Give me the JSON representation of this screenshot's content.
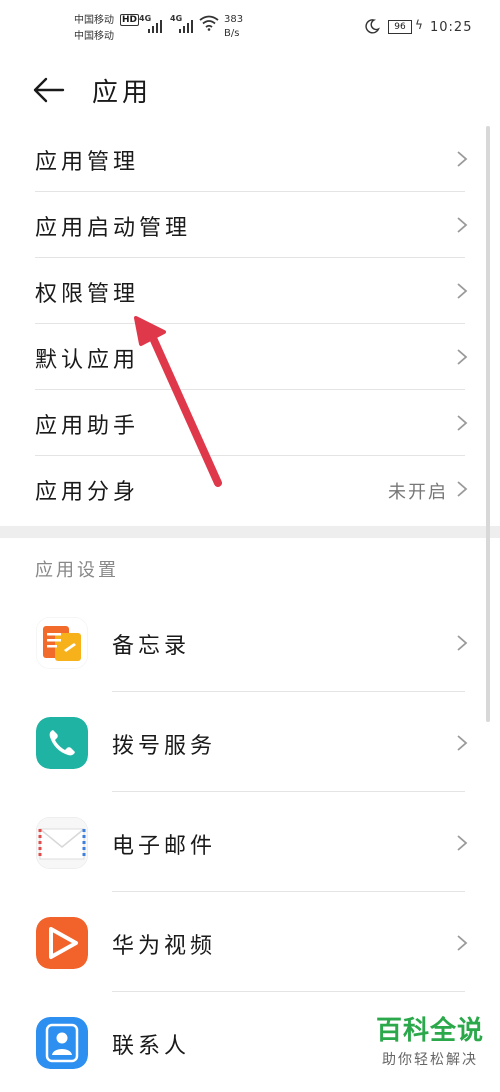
{
  "status_bar": {
    "carrier1": "中国移动",
    "carrier2": "中国移动",
    "hd": "HD",
    "net1": "4G",
    "net2": "4G",
    "speed_value": "383",
    "speed_unit": "B/s",
    "battery": "96",
    "time": "10:25"
  },
  "header": {
    "title": "应用"
  },
  "list": [
    {
      "label": "应用管理"
    },
    {
      "label": "应用启动管理"
    },
    {
      "label": "权限管理"
    },
    {
      "label": "默认应用"
    },
    {
      "label": "应用助手"
    },
    {
      "label": "应用分身",
      "value": "未开启"
    }
  ],
  "section_title": "应用设置",
  "apps": [
    {
      "label": "备忘录",
      "icon": "memo-icon"
    },
    {
      "label": "拨号服务",
      "icon": "phone-icon"
    },
    {
      "label": "电子邮件",
      "icon": "email-icon"
    },
    {
      "label": "华为视频",
      "icon": "video-icon"
    },
    {
      "label": "联系人",
      "icon": "contacts-icon"
    }
  ],
  "watermark": {
    "main": "百科全说",
    "sub": "助你轻松解决"
  },
  "colors": {
    "annotation_arrow": "#e0384b",
    "watermark": "#2aa84a"
  }
}
